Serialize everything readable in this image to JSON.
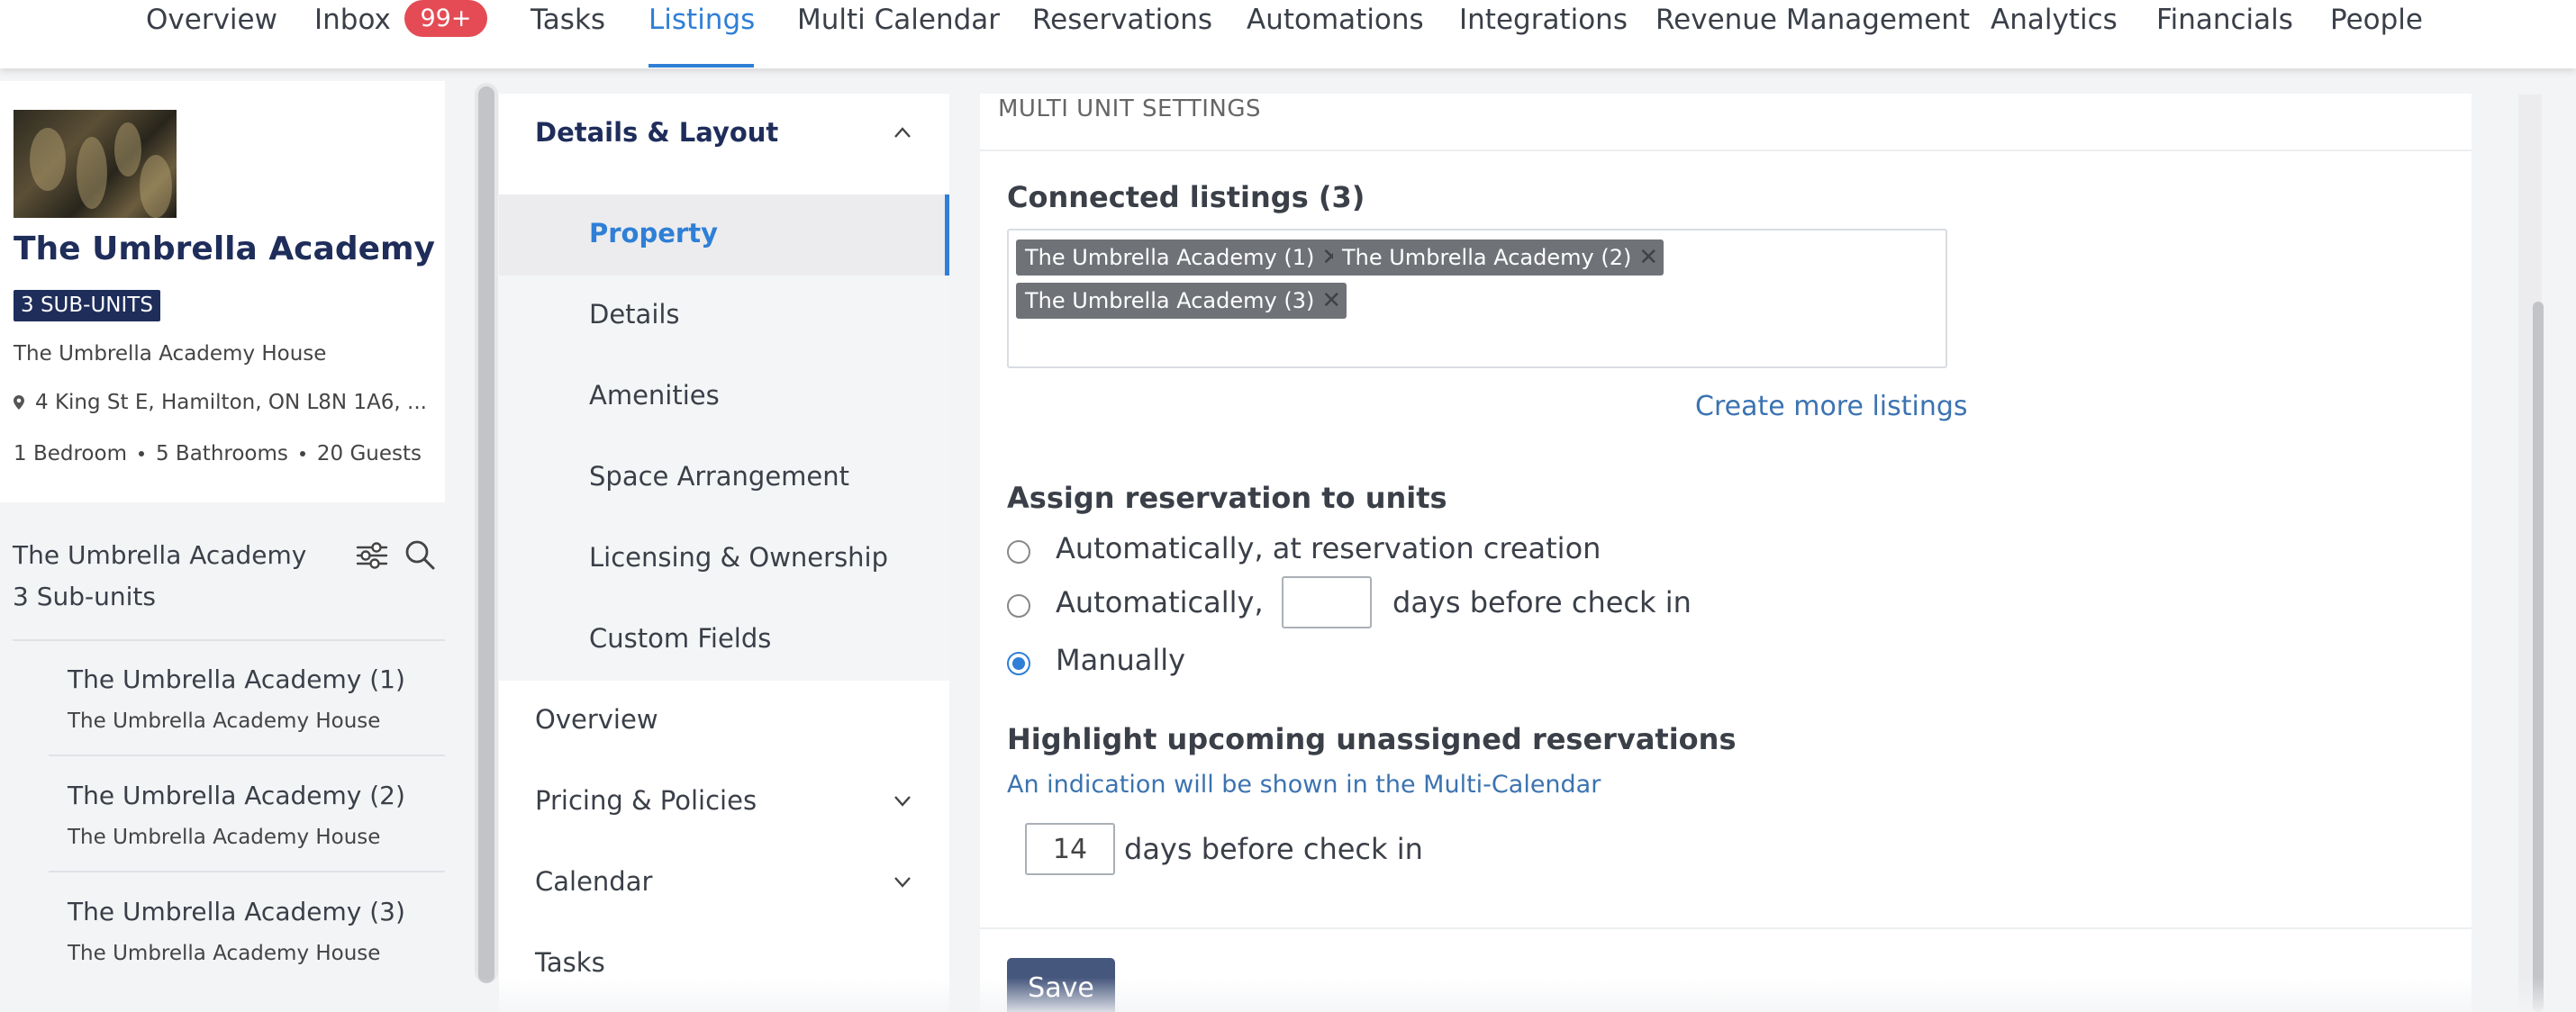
{
  "nav": {
    "items": [
      "Overview",
      "Inbox",
      "Tasks",
      "Listings",
      "Multi Calendar",
      "Reservations",
      "Automations",
      "Integrations",
      "Revenue Management",
      "Analytics",
      "Financials",
      "People"
    ],
    "inbox_badge": "99+",
    "active": "Listings"
  },
  "listing": {
    "title": "The Umbrella Academy",
    "subunits_badge": "3 SUB-UNITS",
    "house": "The Umbrella Academy House",
    "address": "4 King St E, Hamilton, ON L8N 1A6, ...",
    "bedrooms": "1 Bedroom",
    "bathrooms": "5 Bathrooms",
    "guests": "20 Guests"
  },
  "subunits": {
    "name": "The Umbrella Academy",
    "count": "3 Sub-units",
    "items": [
      {
        "title": "The Umbrella Academy (1)",
        "subtitle": "The Umbrella Academy House"
      },
      {
        "title": "The Umbrella Academy (2)",
        "subtitle": "The Umbrella Academy House"
      },
      {
        "title": "The Umbrella Academy (3)",
        "subtitle": "The Umbrella Academy House"
      }
    ]
  },
  "settings_nav": {
    "group": "Details & Layout",
    "sub_items": [
      "Property",
      "Details",
      "Amenities",
      "Space Arrangement",
      "Licensing & Ownership",
      "Custom Fields"
    ],
    "active": "Property",
    "top_items": [
      "Overview",
      "Pricing & Policies",
      "Calendar",
      "Tasks"
    ]
  },
  "main": {
    "section_title": "MULTI UNIT SETTINGS",
    "connected_heading": "Connected listings (3)",
    "tags": [
      "The Umbrella Academy (1)",
      "The Umbrella Academy (2)",
      "The Umbrella Academy (3)"
    ],
    "create_link": "Create more listings",
    "assign_heading": "Assign reservation to units",
    "options": {
      "auto_creation": "Automatically, at reservation creation",
      "auto_days_prefix": "Automatically,",
      "auto_days_value": "",
      "auto_days_suffix": "days before check in",
      "manual": "Manually"
    },
    "selected_option": "manual",
    "highlight_heading": "Highlight upcoming unassigned reservations",
    "highlight_hint": "An indication will be shown in the Multi-Calendar",
    "highlight_days_value": "14",
    "highlight_days_suffix": "days before check in",
    "save_label": "Save"
  },
  "colors": {
    "accent": "#2f7fd6",
    "navy": "#1e2d5a",
    "badge_red": "#e44b54",
    "save_button": "#46577d",
    "tag": "#6f7378"
  }
}
